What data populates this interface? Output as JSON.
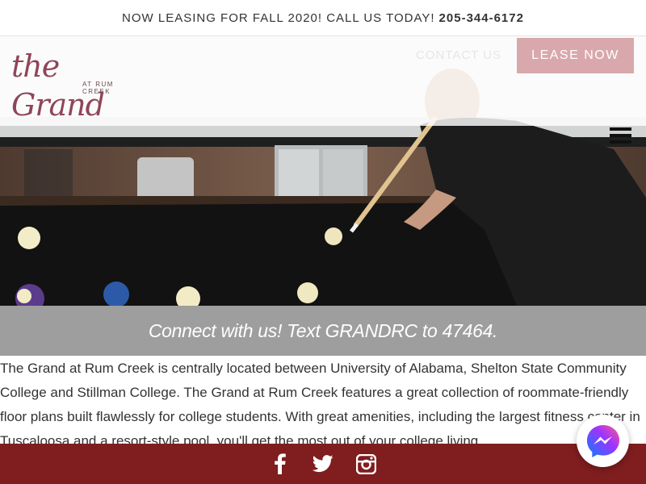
{
  "topbar": {
    "announcement": "NOW LEASING FOR FALL 2020! CALL US TODAY!",
    "phone": "205-344-6172"
  },
  "header": {
    "logo_main": "the Grand",
    "logo_sub": "AT RUM CREEK",
    "contact_label": "CONTACT US",
    "lease_label": "LEASE NOW",
    "menu_icon": "hamburger-menu-icon"
  },
  "connect": {
    "text": "Connect with us! Text GRANDRC to 47464."
  },
  "intro": {
    "text": "The Grand at Rum Creek is centrally located between University of Alabama, Shelton State Community College and Stillman College. The Grand at Rum Creek features a great collection of roommate-friendly floor plans built flawlessly for college students. With great amenities, including the largest fitness center in Tuscaloosa and a resort-style pool, you'll get the most out of your college living."
  },
  "footer": {
    "icons": [
      "facebook-icon",
      "twitter-icon",
      "instagram-icon"
    ]
  },
  "colors": {
    "brand_maroon": "#7f1d1f",
    "lease_button": "#d9a8ac",
    "logo": "#8f4558",
    "banner_gray": "#9e9e9e"
  }
}
